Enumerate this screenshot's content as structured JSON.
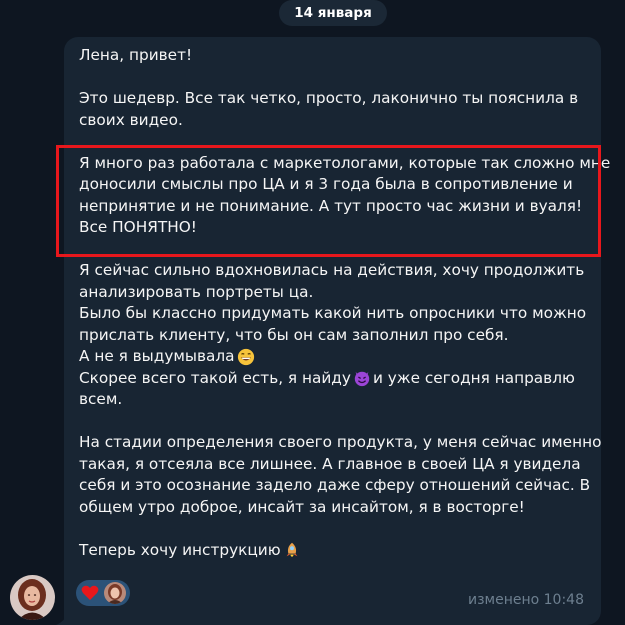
{
  "date_label": "14 января",
  "message": {
    "lines": [
      "Лена, привет!",
      "",
      "Это шедевр. Все так четко, просто, лаконично ты пояснила в",
      "своих видео.",
      "",
      "Я много раз работала с маркетологами, которые так сложно мне",
      "доносили смыслы про ЦА и я 3 года была в сопротивление и",
      "непринятие и не понимание. А тут просто час жизни и вуаля!",
      "Все ПОНЯТНО!",
      "",
      "Я сейчас сильно вдохновилась на действия, хочу продолжить",
      "анализировать портреты ца.",
      "Было бы классно придумать какой нить опросники что можно",
      "прислать клиенту, что бы он сам заполнил про себя.",
      "А не я выдумывала",
      "Скорее всего такой есть, я найду",
      "всем.",
      "",
      "На стадии определения своего продукта, у меня сейчас именно",
      "такая, я отсеяла все лишнее. А главное в своей ЦА я увидела",
      "себя и это осознание задело даже сферу отношений сейчас. В",
      "общем утро доброе, инсайт за инсайтом, я в восторге!",
      "",
      "Теперь хочу инструкцию"
    ],
    "line16_after_emoji": " и уже сегодня направлю",
    "meta": "изменено 10:48"
  },
  "emojis": {
    "grin": "grinning-face-emoji",
    "devil": "smiling-devil-emoji",
    "rocket": "fire-rocket-emoji"
  },
  "colors": {
    "background": "#0e1621",
    "bubble": "#182533",
    "highlight_border": "#e8171c",
    "reaction_bg": "#2b5278",
    "meta_text": "#6d7f8f"
  }
}
